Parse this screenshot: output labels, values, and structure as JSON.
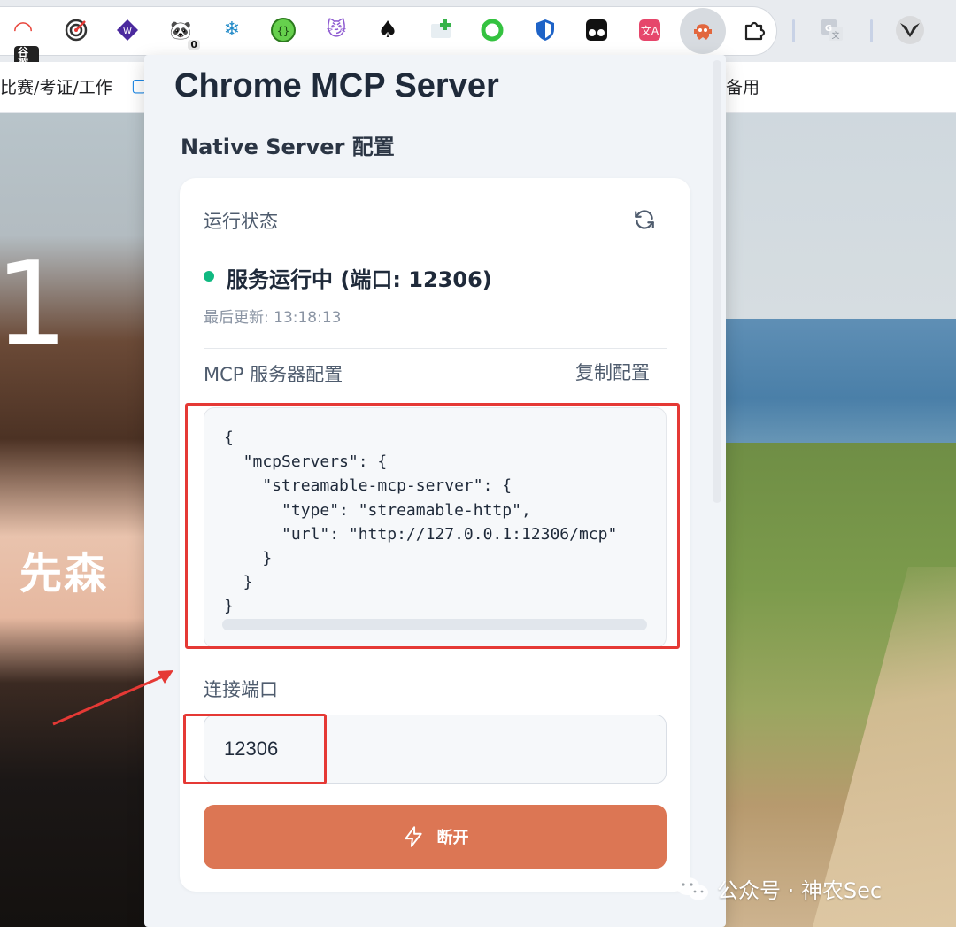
{
  "toolbar": {
    "extensions": [
      {
        "icon": "google-translate-badge-icon",
        "badge": "谷歌"
      },
      {
        "icon": "target-icon"
      },
      {
        "icon": "purple-diamond-icon"
      },
      {
        "icon": "panda-icon",
        "count": "0"
      },
      {
        "icon": "snowflake-icon"
      },
      {
        "icon": "json-braces-icon"
      },
      {
        "icon": "kitty-icon"
      },
      {
        "icon": "spade-code-icon"
      },
      {
        "icon": "green-plus-icon"
      },
      {
        "icon": "green-ring-icon"
      },
      {
        "icon": "shield-icon"
      },
      {
        "icon": "tampermonkey-icon"
      },
      {
        "icon": "translate-icon"
      },
      {
        "icon": "mcp-robot-icon",
        "active": true
      },
      {
        "icon": "puzzle-icon"
      }
    ]
  },
  "bookmarks": {
    "left_item": "比赛/考证/工作",
    "right_item": "备用"
  },
  "background": {
    "big_char": "1",
    "name_text": "先森"
  },
  "popup": {
    "title": "Chrome MCP Server",
    "section_title": "Native Server 配置",
    "status_label": "运行状态",
    "status_text": "服务运行中 (端口: 12306)",
    "last_updated": "最后更新: 13:18:13",
    "config_label": "MCP 服务器配置",
    "copy_label": "复制配置",
    "config_json": "{\n  \"mcpServers\": {\n    \"streamable-mcp-server\": {\n      \"type\": \"streamable-http\",\n      \"url\": \"http://127.0.0.1:12306/mcp\"\n    }\n  }\n}",
    "port_label": "连接端口",
    "port_value": "12306",
    "disconnect_label": "断开"
  },
  "watermark": "公众号 · 神农Sec",
  "colors": {
    "accent": "#dc7654",
    "status_green": "#10b981",
    "annotation_red": "#e53935"
  }
}
